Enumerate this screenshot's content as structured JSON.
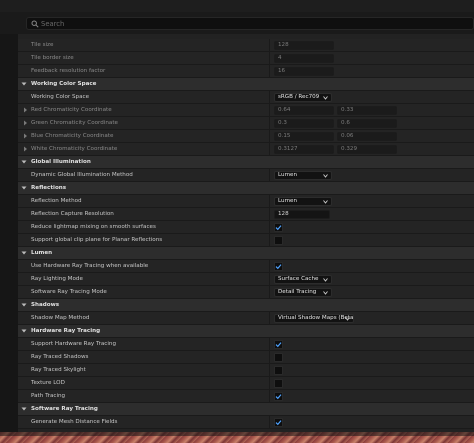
{
  "search": {
    "placeholder": "Search"
  },
  "rows": [
    {
      "kind": "prop",
      "label": "Tile size",
      "dim": true,
      "value": "128",
      "valueDim": true
    },
    {
      "kind": "prop",
      "label": "Tile border size",
      "dim": true,
      "value": "4",
      "valueDim": true
    },
    {
      "kind": "prop",
      "label": "Feedback resolution factor",
      "dim": true,
      "value": "16",
      "valueDim": true
    },
    {
      "kind": "cat",
      "label": "Working Color Space"
    },
    {
      "kind": "prop",
      "label": "Working Color Space",
      "combo": "sRGB / Rec709"
    },
    {
      "kind": "prop",
      "label": "Red Chromaticity Coordinate",
      "dim": true,
      "sub": true,
      "pair": [
        "0.64",
        "0.33"
      ]
    },
    {
      "kind": "prop",
      "label": "Green Chromaticity Coordinate",
      "dim": true,
      "sub": true,
      "pair": [
        "0.3",
        "0.6"
      ]
    },
    {
      "kind": "prop",
      "label": "Blue Chromaticity Coordinate",
      "dim": true,
      "sub": true,
      "pair": [
        "0.15",
        "0.06"
      ]
    },
    {
      "kind": "prop",
      "label": "White Chromaticity Coordinate",
      "dim": true,
      "sub": true,
      "pair": [
        "0.3127",
        "0.329"
      ]
    },
    {
      "kind": "cat",
      "label": "Global Illumination"
    },
    {
      "kind": "prop",
      "label": "Dynamic Global Illumination Method",
      "combo": "Lumen"
    },
    {
      "kind": "cat",
      "label": "Reflections"
    },
    {
      "kind": "prop",
      "label": "Reflection Method",
      "combo": "Lumen"
    },
    {
      "kind": "prop",
      "label": "Reflection Capture Resolution",
      "value": "128"
    },
    {
      "kind": "prop",
      "label": "Reduce lightmap mixing on smooth surfaces",
      "check": true
    },
    {
      "kind": "prop",
      "label": "Support global clip plane for Planar Reflections",
      "check": false
    },
    {
      "kind": "cat",
      "label": "Lumen"
    },
    {
      "kind": "prop",
      "label": "Use Hardware Ray Tracing when available",
      "check": true
    },
    {
      "kind": "prop",
      "label": "Ray Lighting Mode",
      "combo": "Surface Cache"
    },
    {
      "kind": "prop",
      "label": "Software Ray Tracing Mode",
      "combo": "Detail Tracing"
    },
    {
      "kind": "cat",
      "label": "Shadows"
    },
    {
      "kind": "prop",
      "label": "Shadow Map Method",
      "combo": "Virtual Shadow Maps (Beta)",
      "wide": true
    },
    {
      "kind": "cat",
      "label": "Hardware Ray Tracing"
    },
    {
      "kind": "prop",
      "label": "Support Hardware Ray Tracing",
      "check": true
    },
    {
      "kind": "prop",
      "label": "Ray Traced Shadows",
      "check": false
    },
    {
      "kind": "prop",
      "label": "Ray Traced Skylight",
      "check": false
    },
    {
      "kind": "prop",
      "label": "Texture LOD",
      "check": false
    },
    {
      "kind": "prop",
      "label": "Path Tracing",
      "check": true
    },
    {
      "kind": "cat",
      "label": "Software Ray Tracing"
    },
    {
      "kind": "prop",
      "label": "Generate Mesh Distance Fields",
      "check": true
    }
  ],
  "colors": {
    "accent": "#4fa3ff",
    "panel": "#242424",
    "category": "#2d2d2d"
  }
}
